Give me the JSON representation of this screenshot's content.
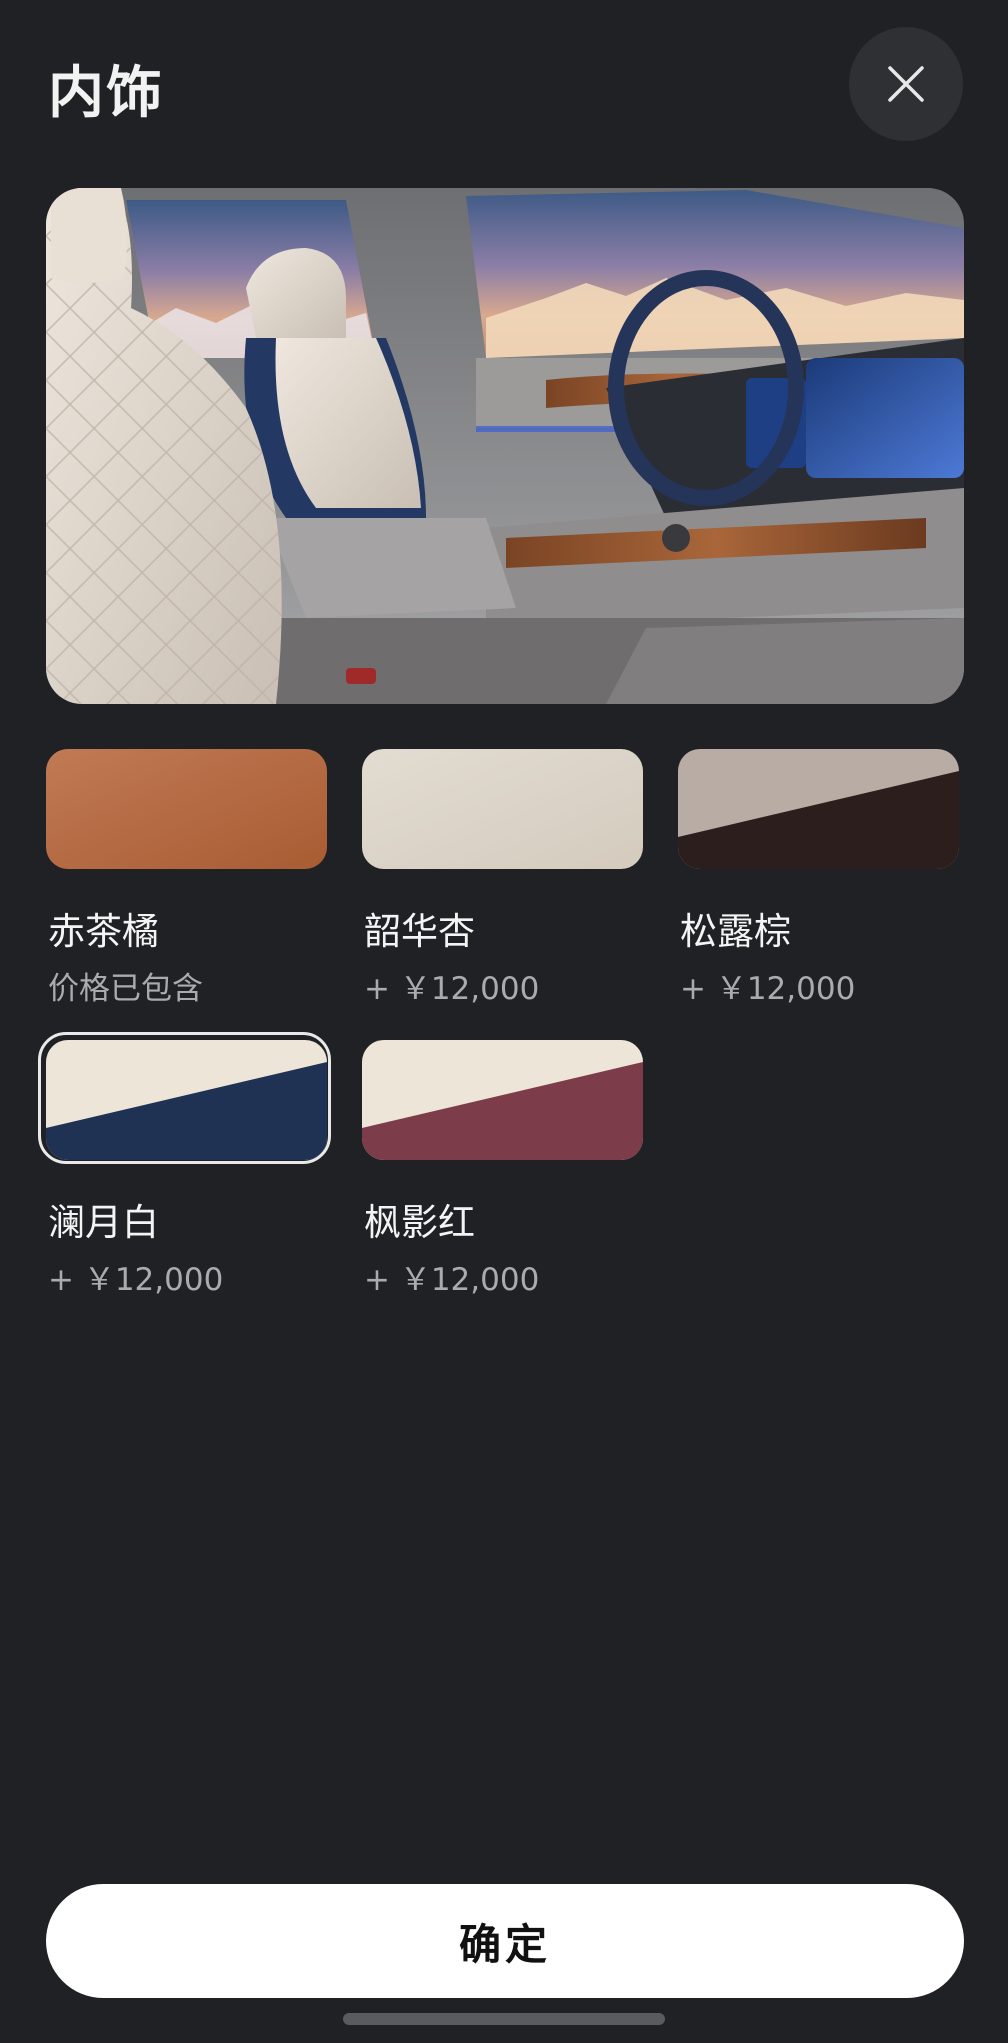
{
  "header": {
    "title": "内饰",
    "close_icon": "close-icon"
  },
  "colors": {
    "background": "#202124",
    "button_bg": "#ffffff",
    "price_text": "#a9abae"
  },
  "swatches": [
    {
      "name": "赤茶橘",
      "price": "价格已包含",
      "selected": false,
      "top": "#b06a44",
      "bottom": "#b06a44"
    },
    {
      "name": "韶华杏",
      "price": "+ ￥12,000",
      "selected": false,
      "top": "#ddd6cb",
      "bottom": "#ddd6cb"
    },
    {
      "name": "松露棕",
      "price": "+ ￥12,000",
      "selected": false,
      "top": "#b8aba3",
      "bottom": "#2a1d1c"
    },
    {
      "name": "澜月白",
      "price": "+ ￥12,000",
      "selected": true,
      "top": "#ece5d8",
      "bottom": "#1e3152"
    },
    {
      "name": "枫影红",
      "price": "+ ￥12,000",
      "selected": false,
      "top": "#ece5d8",
      "bottom": "#7c3b48"
    }
  ],
  "footer": {
    "confirm_label": "确定"
  }
}
